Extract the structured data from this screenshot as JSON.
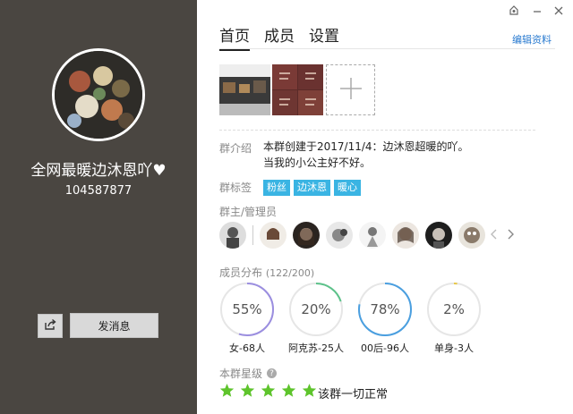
{
  "profile": {
    "group_name": "全网最暖边沐恩吖♥",
    "group_id": "104587877",
    "send_message_label": "发消息"
  },
  "tabs": [
    {
      "label": "首页",
      "active": true
    },
    {
      "label": "成员",
      "active": false
    },
    {
      "label": "设置",
      "active": false
    }
  ],
  "edit_profile_label": "编辑资料",
  "intro": {
    "label": "群介绍",
    "line1": "本群创建于2017/11/4：边沐恩超暖的吖。",
    "line2": "当我的小公主好不好。"
  },
  "tags": {
    "label": "群标签",
    "items": [
      "粉丝",
      "边沐恩",
      "暖心"
    ]
  },
  "admins": {
    "label": "群主/管理员"
  },
  "distribution": {
    "title": "成员分布",
    "count": "(122/200)",
    "items": [
      {
        "percent_text": "55%",
        "fraction": 0.55,
        "label": "女-68人",
        "color": "#9b8ee0"
      },
      {
        "percent_text": "20%",
        "fraction": 0.2,
        "label": "阿克苏-25人",
        "color": "#5cc28a"
      },
      {
        "percent_text": "78%",
        "fraction": 0.78,
        "label": "00后-96人",
        "color": "#4a9fe0"
      },
      {
        "percent_text": "2%",
        "fraction": 0.02,
        "label": "单身-3人",
        "color": "#e8c84a"
      }
    ]
  },
  "rank": {
    "title": "本群星级",
    "stars": 5,
    "status": "该群一切正常",
    "star_color": "#5ec42c"
  }
}
